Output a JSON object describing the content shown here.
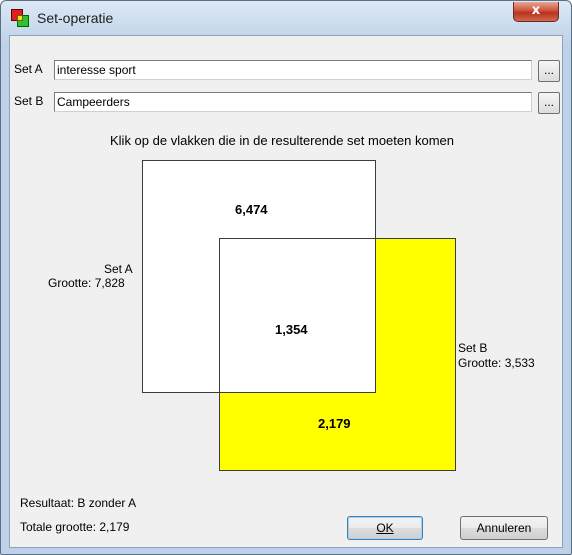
{
  "window": {
    "title": "Set-operatie",
    "close_label": "x"
  },
  "set_a": {
    "label": "Set A",
    "value": "interesse sport",
    "browse_label": "..."
  },
  "set_b": {
    "label": "Set B",
    "value": "Campeerders",
    "browse_label": "..."
  },
  "instruction": "Klik op de vlakken die in de resulterende set moeten komen",
  "diagram": {
    "a_only": {
      "count": "6,474",
      "selected": false
    },
    "a_and_b": {
      "count": "1,354",
      "selected": false
    },
    "b_only": {
      "count": "2,179",
      "selected": true
    },
    "set_a_caption": {
      "name": "Set A",
      "size": "Grootte: 7,828"
    },
    "set_b_caption": {
      "name": "Set B",
      "size": "Grootte: 3,533"
    },
    "colors": {
      "selected": "#ffff00",
      "unselected": "#ffffff"
    }
  },
  "footer": {
    "result": "Resultaat: B zonder A",
    "total": "Totale grootte: 2,179",
    "ok_label": "OK",
    "cancel_label": "Annuleren"
  }
}
